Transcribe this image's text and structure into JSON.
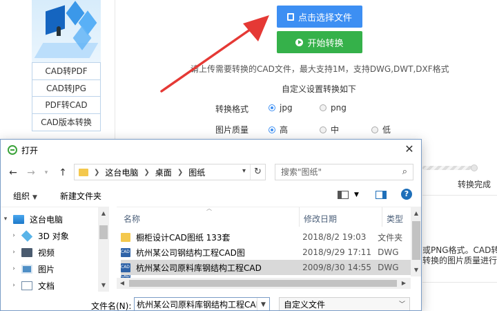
{
  "site": {
    "menu": [
      "CAD转PDF",
      "CAD转JPG",
      "PDF转CAD",
      "CAD版本转换"
    ],
    "select_button": "点击选择文件",
    "start_button": "开始转换",
    "hint": "请上传需要转换的CAD文件，最大支持1M，支持DWG,DWT,DXF格式",
    "settings_title": "自定义设置转换如下",
    "format_label": "转换格式",
    "format_options": [
      "jpg",
      "png"
    ],
    "quality_label": "图片质量",
    "quality_options": [
      "高",
      "中",
      "低"
    ],
    "status": "转换完成",
    "note_line1": "或PNG格式。CAD转",
    "note_line2": "转换的图片质量进行转",
    "colors": {
      "select_button": "#3d8ff3",
      "start_button": "#35b14a",
      "arrow": "#e53935"
    }
  },
  "dialog": {
    "title": "打开",
    "close": "✕",
    "breadcrumb": [
      "这台电脑",
      "桌面",
      "图纸"
    ],
    "search_placeholder": "搜索\"图纸\"",
    "toolbar": {
      "organize": "组织",
      "new_folder": "新建文件夹"
    },
    "tree": [
      "这台电脑",
      "3D 对象",
      "视频",
      "图片",
      "文档"
    ],
    "columns": {
      "name": "名称",
      "date": "修改日期",
      "type": "类型"
    },
    "files": [
      {
        "name": "橱柜设计CAD图纸 133套",
        "date": "2018/8/2 19:03",
        "type": "文件夹"
      },
      {
        "name": "杭州某公司钢结构工程CAD图",
        "date": "2018/9/29 17:11",
        "type": "DWG"
      },
      {
        "name": "杭州某公司原料库钢结构工程CAD",
        "date": "2009/8/30 14:55",
        "type": "DWG"
      }
    ],
    "filename_label": "文件名(N):",
    "filename_value": "杭州某公司原料库钢结构工程CAD",
    "filetype": "自定义文件"
  }
}
